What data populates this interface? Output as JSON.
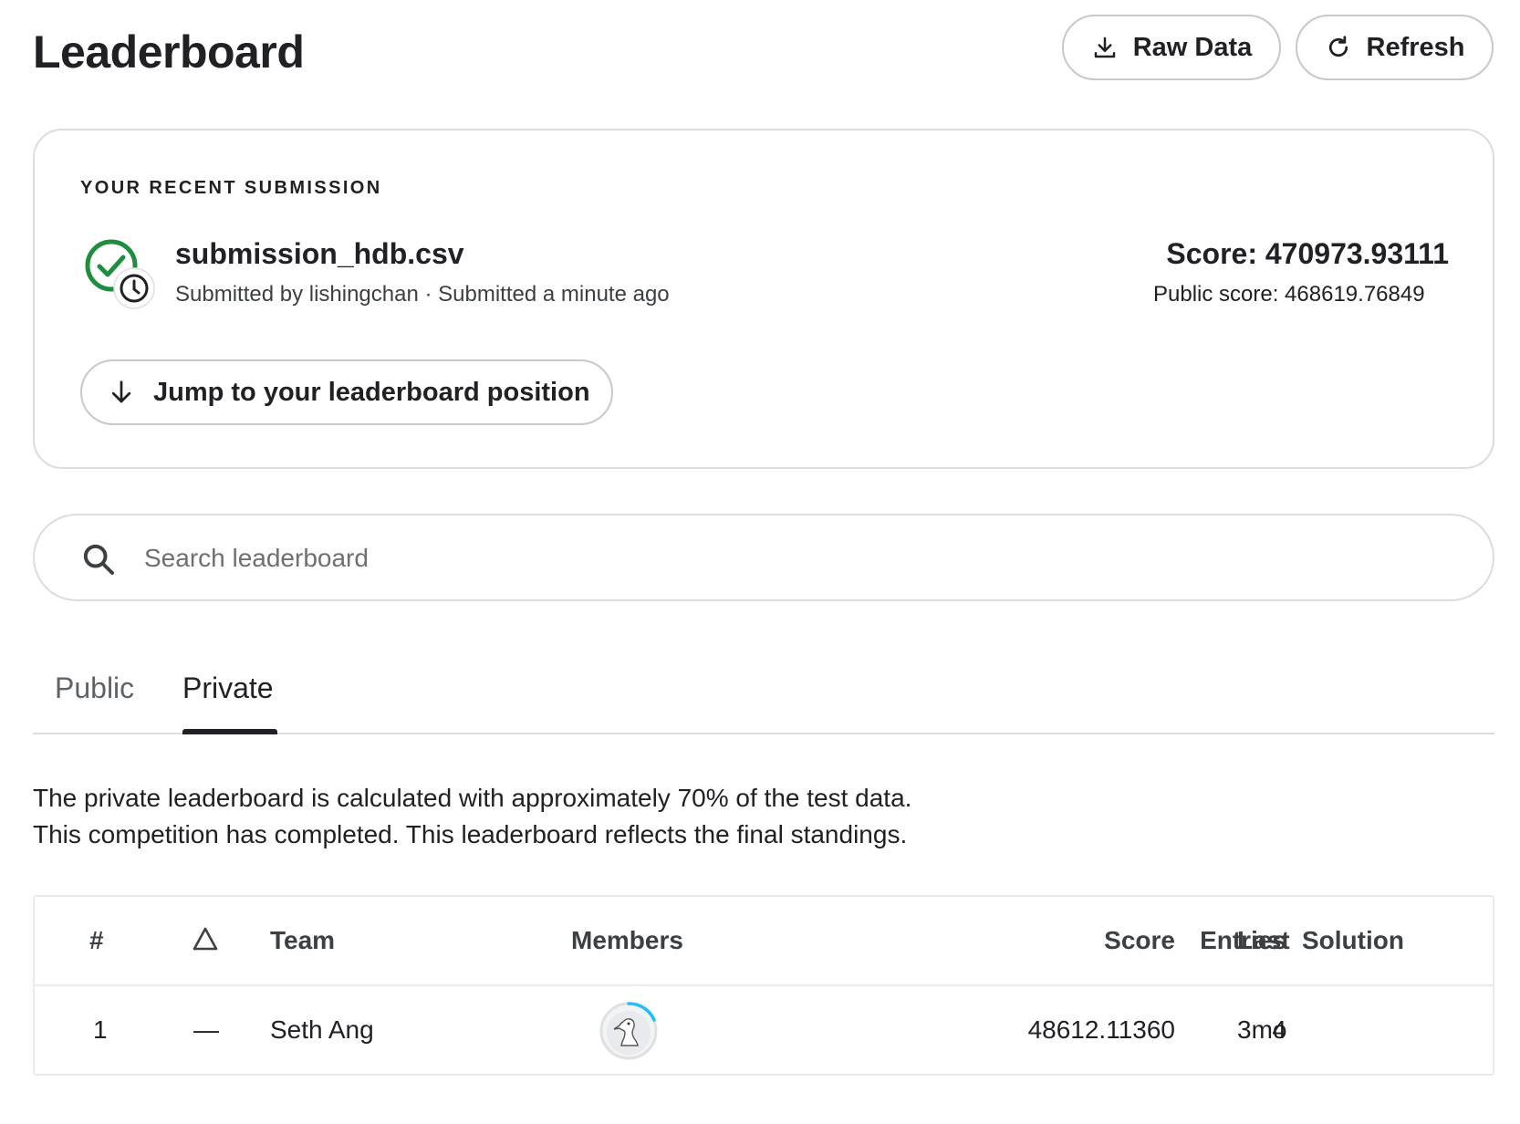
{
  "header": {
    "title": "Leaderboard",
    "raw_data_label": "Raw Data",
    "refresh_label": "Refresh"
  },
  "recent_submission": {
    "heading": "YOUR RECENT SUBMISSION",
    "file_name": "submission_hdb.csv",
    "submitted_line": "Submitted by lishingchan · Submitted a minute ago",
    "score": "Score: 470973.93111",
    "public_score": "Public score: 468619.76849",
    "jump_label": "Jump to your leaderboard position"
  },
  "search": {
    "placeholder": "Search leaderboard",
    "value": ""
  },
  "tabs": {
    "public": "Public",
    "private": "Private",
    "active": "Private"
  },
  "description": {
    "line1": "The private leaderboard is calculated with approximately 70% of the test data.",
    "line2": "This competition has completed. This leaderboard reflects the final standings."
  },
  "table": {
    "columns": {
      "rank": "#",
      "delta": "△",
      "team": "Team",
      "members": "Members",
      "score": "Score",
      "entries": "Entries",
      "last": "Last",
      "solution": "Solution"
    },
    "rows": [
      {
        "rank": "1",
        "delta": "—",
        "team": "Seth Ang",
        "member_avatar": "goose-avatar-icon",
        "score": "48612.11360",
        "entries": "4",
        "last": "3mo",
        "solution": ""
      }
    ]
  },
  "colors": {
    "success_green": "#1e8e3e",
    "progress_ring": "#20beff",
    "text": "#202124",
    "border": "#dadce0"
  }
}
